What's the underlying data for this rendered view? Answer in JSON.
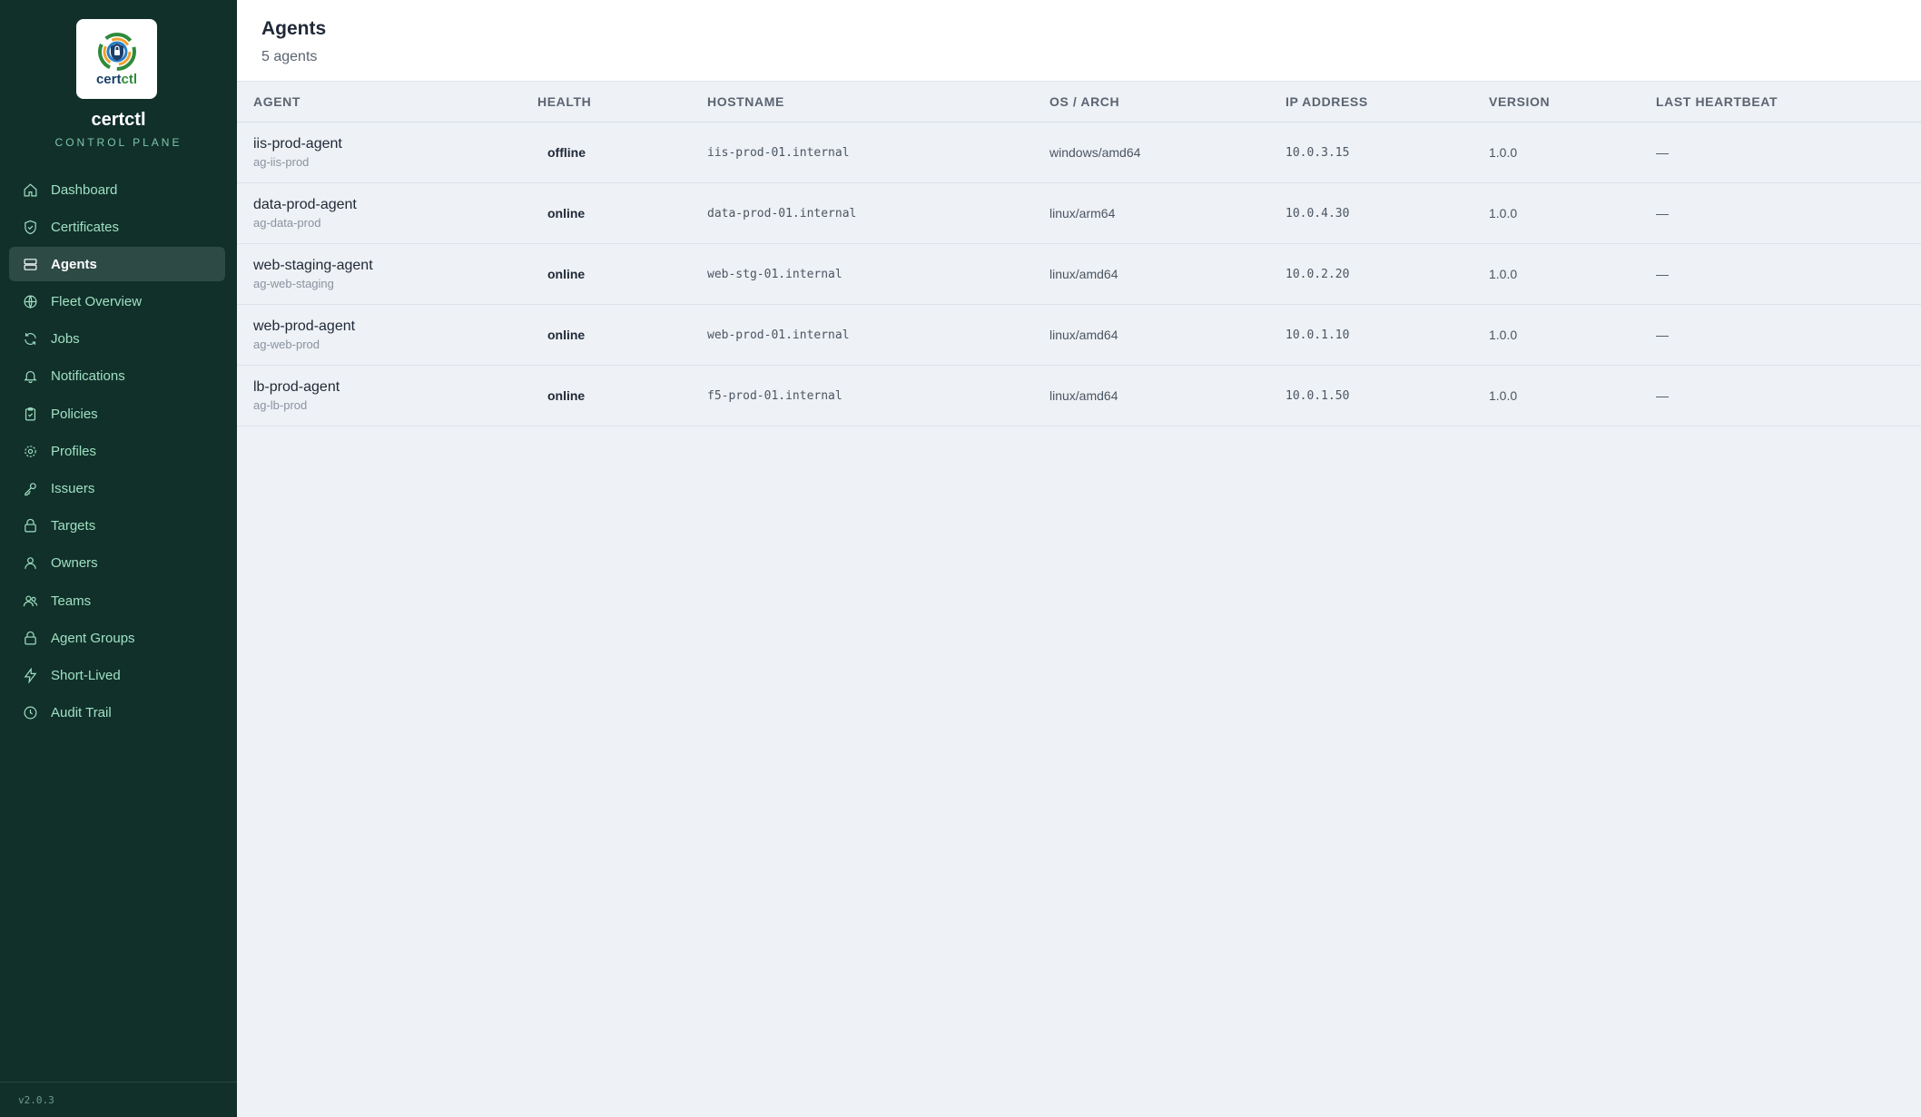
{
  "brand": {
    "logo_text_main": "cert",
    "logo_text_accent": "ctl",
    "name": "certctl",
    "subtitle": "CONTROL PLANE",
    "version": "v2.0.3"
  },
  "sidebar": {
    "items": [
      {
        "label": "Dashboard",
        "icon": "home-icon",
        "active": false
      },
      {
        "label": "Certificates",
        "icon": "shield-check-icon",
        "active": false
      },
      {
        "label": "Agents",
        "icon": "server-icon",
        "active": true
      },
      {
        "label": "Fleet Overview",
        "icon": "globe-icon",
        "active": false
      },
      {
        "label": "Jobs",
        "icon": "refresh-icon",
        "active": false
      },
      {
        "label": "Notifications",
        "icon": "bell-icon",
        "active": false
      },
      {
        "label": "Policies",
        "icon": "clipboard-check-icon",
        "active": false
      },
      {
        "label": "Profiles",
        "icon": "gear-icon",
        "active": false
      },
      {
        "label": "Issuers",
        "icon": "key-icon",
        "active": false
      },
      {
        "label": "Targets",
        "icon": "lock-icon",
        "active": false
      },
      {
        "label": "Owners",
        "icon": "user-icon",
        "active": false
      },
      {
        "label": "Teams",
        "icon": "users-icon",
        "active": false
      },
      {
        "label": "Agent Groups",
        "icon": "lock-icon",
        "active": false
      },
      {
        "label": "Short-Lived",
        "icon": "bolt-icon",
        "active": false
      },
      {
        "label": "Audit Trail",
        "icon": "clock-icon",
        "active": false
      }
    ]
  },
  "header": {
    "title": "Agents",
    "subtitle": "5 agents"
  },
  "table": {
    "columns": [
      "AGENT",
      "HEALTH",
      "HOSTNAME",
      "OS / ARCH",
      "IP ADDRESS",
      "VERSION",
      "LAST HEARTBEAT"
    ],
    "rows": [
      {
        "name": "iis-prod-agent",
        "id": "ag-iis-prod",
        "health": "offline",
        "hostname": "iis-prod-01.internal",
        "os_arch": "windows/amd64",
        "ip": "10.0.3.15",
        "version": "1.0.0",
        "heartbeat": "—"
      },
      {
        "name": "data-prod-agent",
        "id": "ag-data-prod",
        "health": "online",
        "hostname": "data-prod-01.internal",
        "os_arch": "linux/arm64",
        "ip": "10.0.4.30",
        "version": "1.0.0",
        "heartbeat": "—"
      },
      {
        "name": "web-staging-agent",
        "id": "ag-web-staging",
        "health": "online",
        "hostname": "web-stg-01.internal",
        "os_arch": "linux/amd64",
        "ip": "10.0.2.20",
        "version": "1.0.0",
        "heartbeat": "—"
      },
      {
        "name": "web-prod-agent",
        "id": "ag-web-prod",
        "health": "online",
        "hostname": "web-prod-01.internal",
        "os_arch": "linux/amd64",
        "ip": "10.0.1.10",
        "version": "1.0.0",
        "heartbeat": "—"
      },
      {
        "name": "lb-prod-agent",
        "id": "ag-lb-prod",
        "health": "online",
        "hostname": "f5-prod-01.internal",
        "os_arch": "linux/amd64",
        "ip": "10.0.1.50",
        "version": "1.0.0",
        "heartbeat": "—"
      }
    ]
  }
}
